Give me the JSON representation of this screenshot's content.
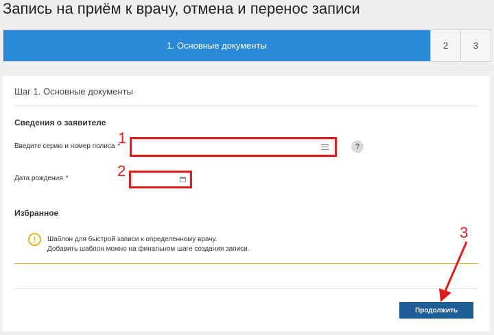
{
  "page": {
    "title": "Запись на приём к врачу, отмена и перенос записи"
  },
  "stepper": {
    "active_label": "1. Основные документы",
    "steps": [
      "2",
      "3"
    ]
  },
  "form": {
    "card_title": "Шаг 1. Основные документы",
    "applicant_section": "Сведения о заявителе",
    "policy_label": "Введите серию и номер полиса",
    "policy_required": "*",
    "policy_value": "",
    "help_label": "?",
    "birthdate_label": "Дата рождения",
    "birthdate_required": "*",
    "birthdate_value": "",
    "favorites_section": "Избранное",
    "notice_icon": "!",
    "notice_line1": "Шаблон для быстрой записи к определенному врачу.",
    "notice_line2": "Добавить шаблон можно на финальном шаге создания записи.",
    "continue_label": "Продолжить"
  },
  "annotations": {
    "marker1": "1",
    "marker2": "2",
    "marker3": "3",
    "color": "#e21b1b"
  },
  "colors": {
    "accent": "#2b89d9",
    "button": "#1d5c97",
    "warning": "#e6b323"
  }
}
